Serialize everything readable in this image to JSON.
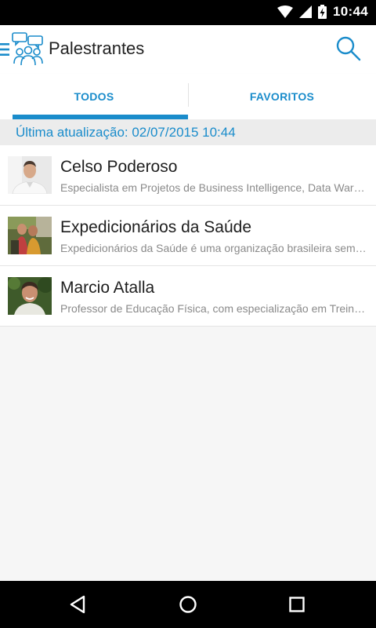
{
  "status_bar": {
    "time": "10:44"
  },
  "app_bar": {
    "title": "Palestrantes"
  },
  "tabs": [
    {
      "label": "TODOS",
      "selected": true
    },
    {
      "label": "FAVORITOS",
      "selected": false
    }
  ],
  "last_update": "Última atualização: 02/07/2015 10:44",
  "speakers": [
    {
      "name": "Celso Poderoso",
      "description": "Especialista em Projetos de Business Intelligence, Data Warehouse e Big Data"
    },
    {
      "name": "Expedicionários da Saúde",
      "description": "Expedicionários da Saúde é uma organização brasileira sem fins lucrativos"
    },
    {
      "name": "Marcio Atalla",
      "description": "Professor de Educação Física, com especialização em Treinamento Desportivo"
    }
  ],
  "colors": {
    "accent": "#1a8ccb",
    "status_bar": "#000000",
    "background": "#f6f6f6"
  }
}
